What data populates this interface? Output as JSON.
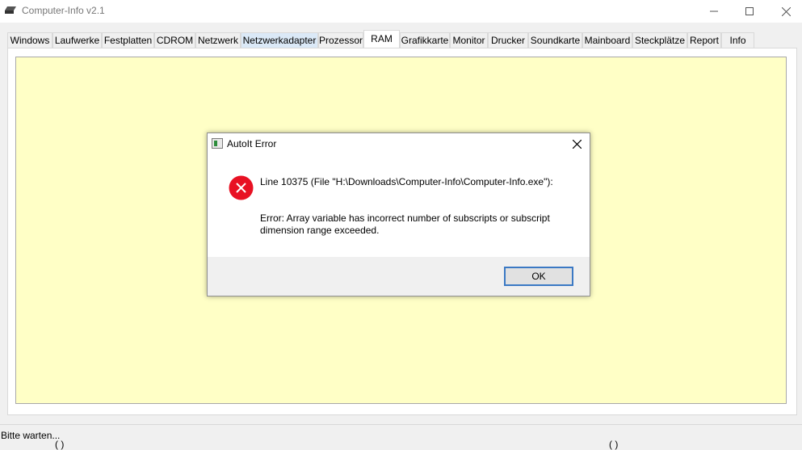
{
  "window": {
    "title": "Computer-Info v2.1",
    "app_icon": "disk-drive-icon",
    "controls": [
      "minimize-icon",
      "maximize-icon",
      "close-icon"
    ]
  },
  "tabs": [
    {
      "label": "Windows"
    },
    {
      "label": "Laufwerke"
    },
    {
      "label": "Festplatten"
    },
    {
      "label": "CDROM"
    },
    {
      "label": "Netzwerk"
    },
    {
      "label": "Netzwerkadapter"
    },
    {
      "label": "Prozessor"
    },
    {
      "label": "RAM"
    },
    {
      "label": "Grafikkarte"
    },
    {
      "label": "Monitor"
    },
    {
      "label": "Drucker"
    },
    {
      "label": "Soundkarte"
    },
    {
      "label": "Mainboard"
    },
    {
      "label": "Steckplätze"
    },
    {
      "label": "Report"
    },
    {
      "label": "Info"
    }
  ],
  "active_tab": "RAM",
  "hovered_tab": "Netzwerkadapter",
  "colors": {
    "content_background": "#ffffc6",
    "error_red": "#e81123",
    "button_focus": "#3b79c4"
  },
  "status": {
    "text": "Bitte warten..."
  },
  "dialog": {
    "title": "AutoIt Error",
    "icon": "error-icon",
    "line1": "Line 10375  (File \"H:\\Downloads\\Computer-Info\\Computer-Info.exe\"):",
    "line2": "Error: Array variable has incorrect number of subscripts or subscript dimension range exceeded.",
    "ok_label": "OK"
  }
}
